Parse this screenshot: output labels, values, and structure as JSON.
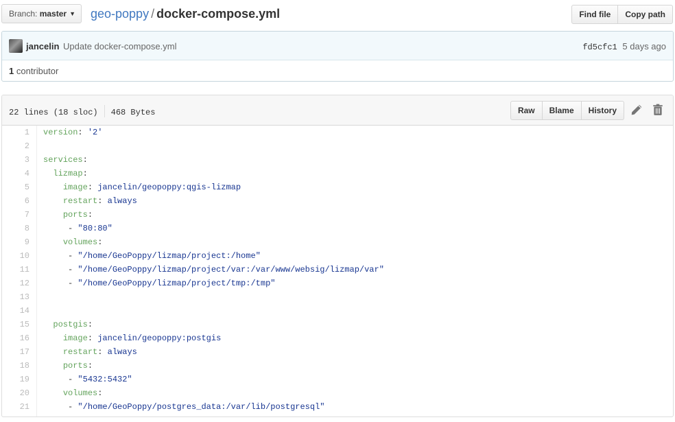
{
  "branch": {
    "prefix": "Branch:",
    "name": "master"
  },
  "breadcrumb": {
    "repo": "geo-poppy",
    "separator": "/",
    "file": "docker-compose.yml"
  },
  "top_buttons": {
    "find_file": "Find file",
    "copy_path": "Copy path"
  },
  "commit": {
    "author": "jancelin",
    "message": "Update docker-compose.yml",
    "sha": "fd5cfc1",
    "age": "5 days ago",
    "contributors_count": "1",
    "contributors_label": "contributor"
  },
  "file": {
    "lines_info": "22 lines (18 sloc)",
    "size": "468 Bytes",
    "actions": {
      "raw": "Raw",
      "blame": "Blame",
      "history": "History"
    }
  },
  "icons": {
    "branch_caret": "caret-down-icon",
    "edit": "pencil-icon",
    "delete": "trash-icon"
  },
  "code_lines": [
    {
      "n": "1",
      "indent": "",
      "key": "version",
      "sep": ": ",
      "val": "'2'"
    },
    {
      "n": "2",
      "indent": "",
      "key": "",
      "sep": "",
      "val": ""
    },
    {
      "n": "3",
      "indent": "",
      "key": "services",
      "sep": ":",
      "val": ""
    },
    {
      "n": "4",
      "indent": "  ",
      "key": "lizmap",
      "sep": ":",
      "val": ""
    },
    {
      "n": "5",
      "indent": "    ",
      "key": "image",
      "sep": ": ",
      "val": "jancelin/geopoppy:qgis-lizmap"
    },
    {
      "n": "6",
      "indent": "    ",
      "key": "restart",
      "sep": ": ",
      "val": "always"
    },
    {
      "n": "7",
      "indent": "    ",
      "key": "ports",
      "sep": ":",
      "val": ""
    },
    {
      "n": "8",
      "indent": "     ",
      "key": "",
      "sep": "- ",
      "val": "\"80:80\""
    },
    {
      "n": "9",
      "indent": "    ",
      "key": "volumes",
      "sep": ":",
      "val": ""
    },
    {
      "n": "10",
      "indent": "     ",
      "key": "",
      "sep": "- ",
      "val": "\"/home/GeoPoppy/lizmap/project:/home\""
    },
    {
      "n": "11",
      "indent": "     ",
      "key": "",
      "sep": "- ",
      "val": "\"/home/GeoPoppy/lizmap/project/var:/var/www/websig/lizmap/var\""
    },
    {
      "n": "12",
      "indent": "     ",
      "key": "",
      "sep": "- ",
      "val": "\"/home/GeoPoppy/lizmap/project/tmp:/tmp\""
    },
    {
      "n": "13",
      "indent": "",
      "key": "",
      "sep": "",
      "val": ""
    },
    {
      "n": "14",
      "indent": "",
      "key": "",
      "sep": "",
      "val": ""
    },
    {
      "n": "15",
      "indent": "  ",
      "key": "postgis",
      "sep": ":",
      "val": ""
    },
    {
      "n": "16",
      "indent": "    ",
      "key": "image",
      "sep": ": ",
      "val": "jancelin/geopoppy:postgis"
    },
    {
      "n": "17",
      "indent": "    ",
      "key": "restart",
      "sep": ": ",
      "val": "always"
    },
    {
      "n": "18",
      "indent": "    ",
      "key": "ports",
      "sep": ":",
      "val": ""
    },
    {
      "n": "19",
      "indent": "     ",
      "key": "",
      "sep": "- ",
      "val": "\"5432:5432\""
    },
    {
      "n": "20",
      "indent": "    ",
      "key": "volumes",
      "sep": ":",
      "val": ""
    },
    {
      "n": "21",
      "indent": "     ",
      "key": "",
      "sep": "- ",
      "val": "\"/home/GeoPoppy/postgres_data:/var/lib/postgresql\""
    }
  ]
}
